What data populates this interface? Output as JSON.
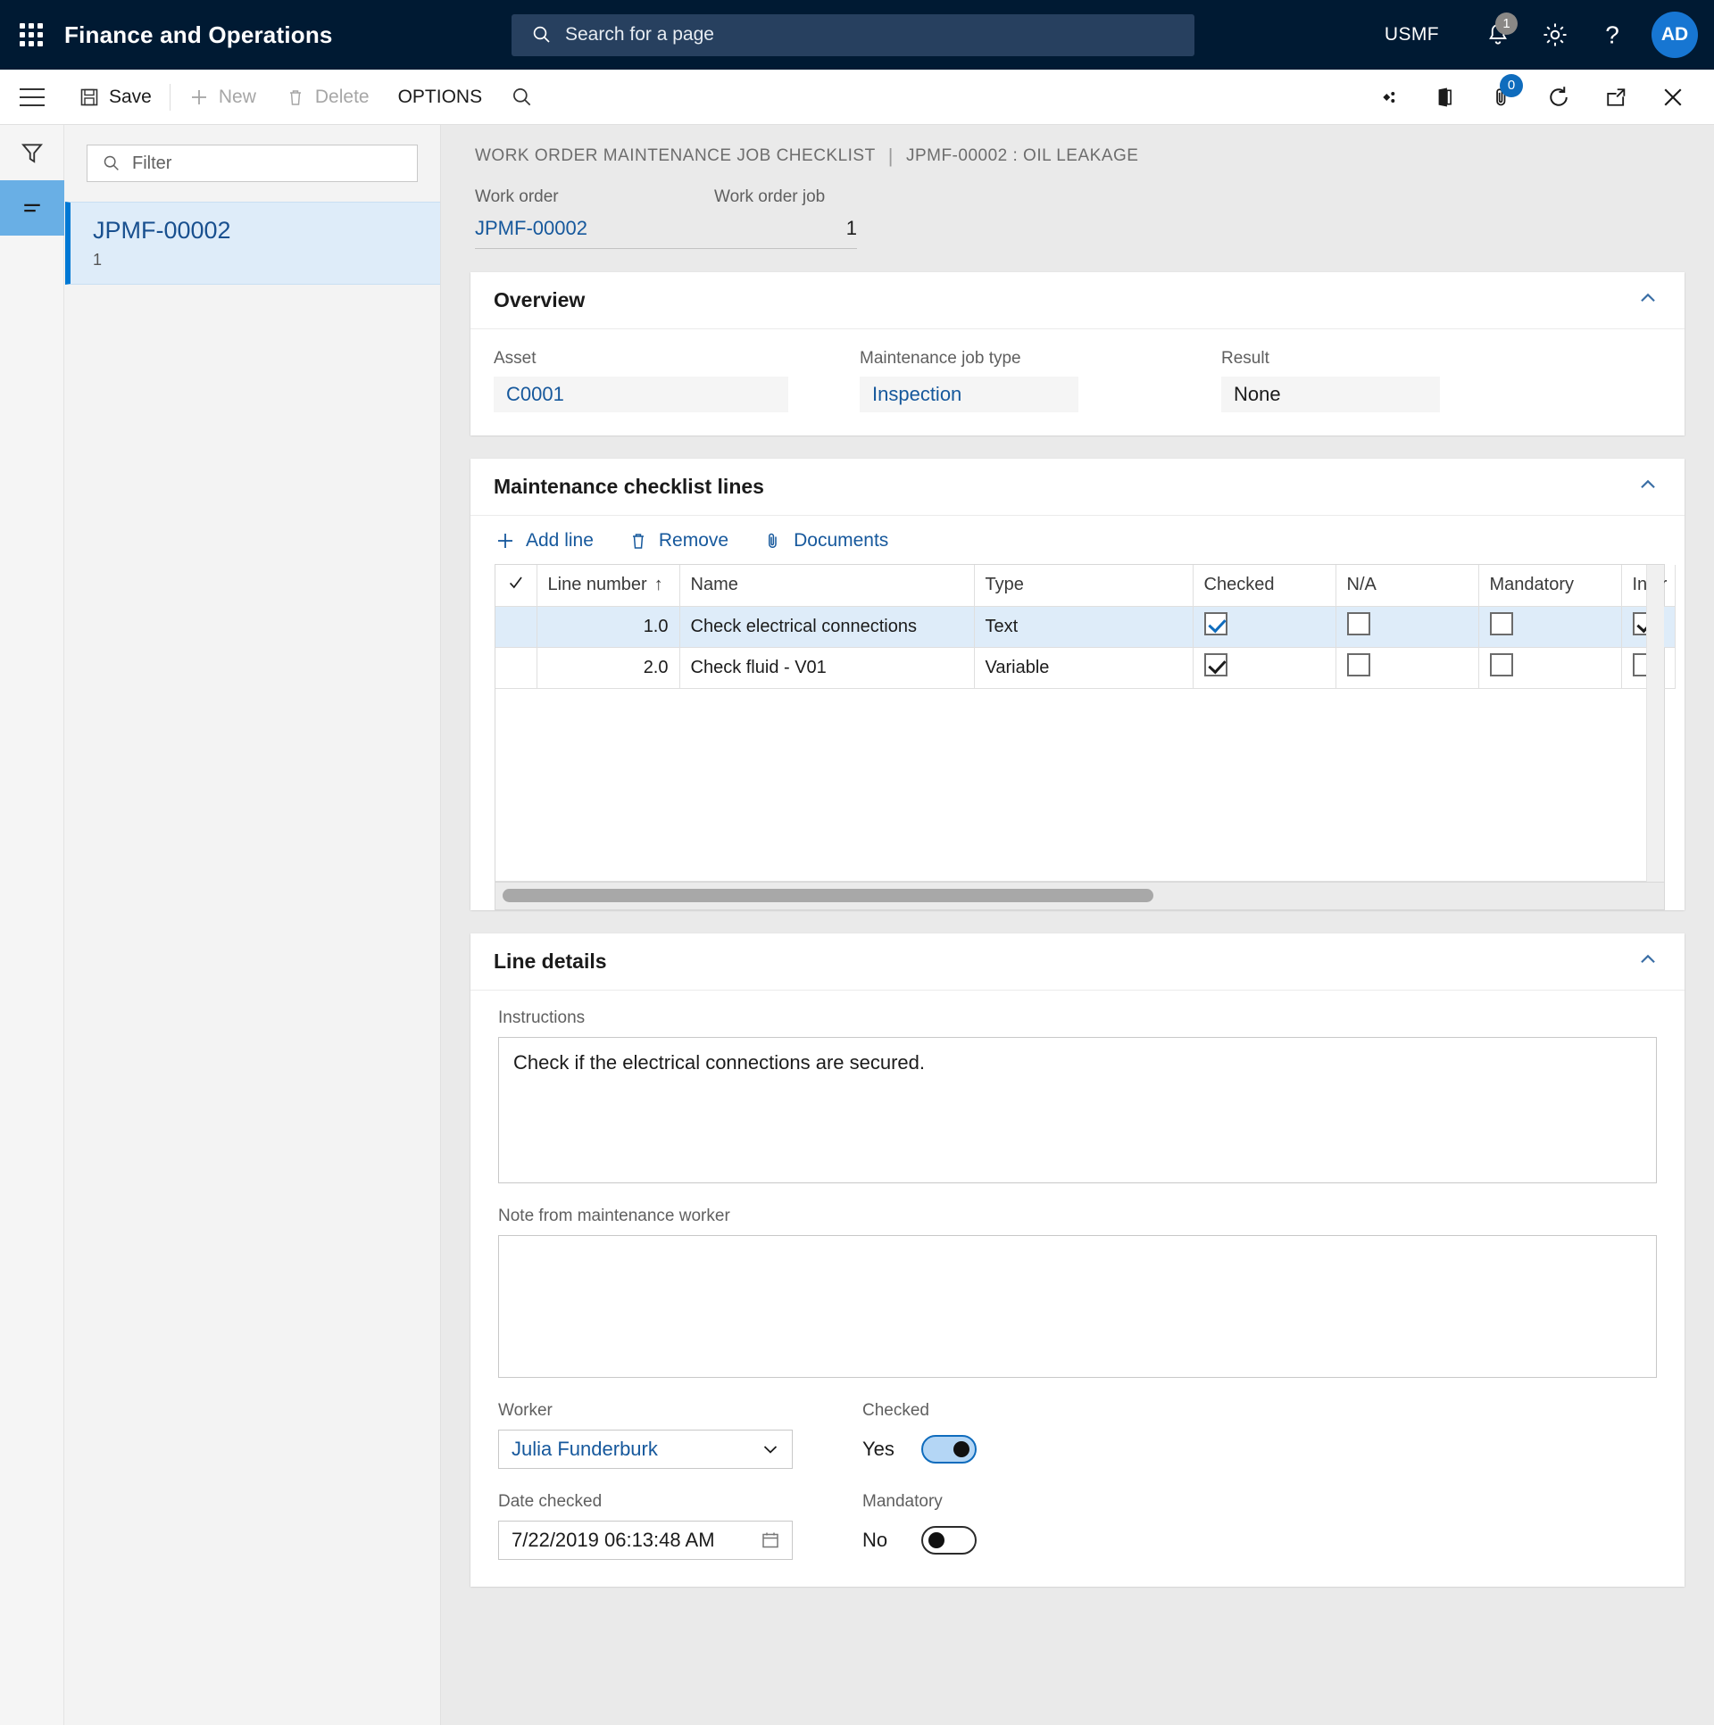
{
  "topbar": {
    "app_title": "Finance and Operations",
    "search_placeholder": "Search for a page",
    "company": "USMF",
    "notification_count": "1",
    "avatar_initials": "AD",
    "icons": {
      "waffle": "app-launcher-icon",
      "search": "search-icon",
      "bell": "notifications-icon",
      "gear": "settings-icon",
      "help": "help-icon"
    }
  },
  "actionbar": {
    "save_label": "Save",
    "new_label": "New",
    "delete_label": "Delete",
    "options_label": "OPTIONS",
    "attachment_count": "0"
  },
  "listpane": {
    "filter_placeholder": "Filter",
    "items": [
      {
        "title": "JPMF-00002",
        "subtitle": "1"
      }
    ]
  },
  "breadcrumb": {
    "section": "WORK ORDER MAINTENANCE JOB CHECKLIST",
    "separator": "|",
    "record": "JPMF-00002 : OIL LEAKAGE"
  },
  "header_fields": [
    {
      "label": "Work order",
      "value": "JPMF-00002",
      "style": "link"
    },
    {
      "label": "Work order job",
      "value": "1",
      "style": "num"
    }
  ],
  "overview": {
    "title": "Overview",
    "fields": [
      {
        "label": "Asset",
        "value": "C0001",
        "style": "link"
      },
      {
        "label": "Maintenance job type",
        "value": "Inspection",
        "style": "link"
      },
      {
        "label": "Result",
        "value": "None",
        "style": "plain"
      }
    ]
  },
  "checklist": {
    "title": "Maintenance checklist lines",
    "toolbar": {
      "add_line": "Add line",
      "remove": "Remove",
      "documents": "Documents"
    },
    "columns": [
      "Line number",
      "Name",
      "Type",
      "Checked",
      "N/A",
      "Mandatory",
      "Instr"
    ],
    "sort_indicator": "↑",
    "rows": [
      {
        "selected": true,
        "line_number": "1.0",
        "name": "Check electrical connections",
        "type": "Text",
        "checked": true,
        "na": false,
        "mandatory": false,
        "instructions": true
      },
      {
        "selected": false,
        "line_number": "2.0",
        "name": "Check fluid - V01",
        "type": "Variable",
        "checked": true,
        "na": false,
        "mandatory": false,
        "instructions": false
      }
    ]
  },
  "line_details": {
    "title": "Line details",
    "instructions_label": "Instructions",
    "instructions_value": "Check if the electrical connections are secured.",
    "note_label": "Note from maintenance worker",
    "note_value": "",
    "worker_label": "Worker",
    "worker_value": "Julia Funderburk",
    "date_label": "Date checked",
    "date_value": "7/22/2019 06:13:48 AM",
    "checked_label": "Checked",
    "checked_value": "Yes",
    "mandatory_label": "Mandatory",
    "mandatory_value": "No"
  },
  "colors": {
    "navy": "#001a33",
    "accent_blue": "#0f6cbd",
    "link_blue": "#16589c",
    "selection_blue": "#deecf9"
  }
}
